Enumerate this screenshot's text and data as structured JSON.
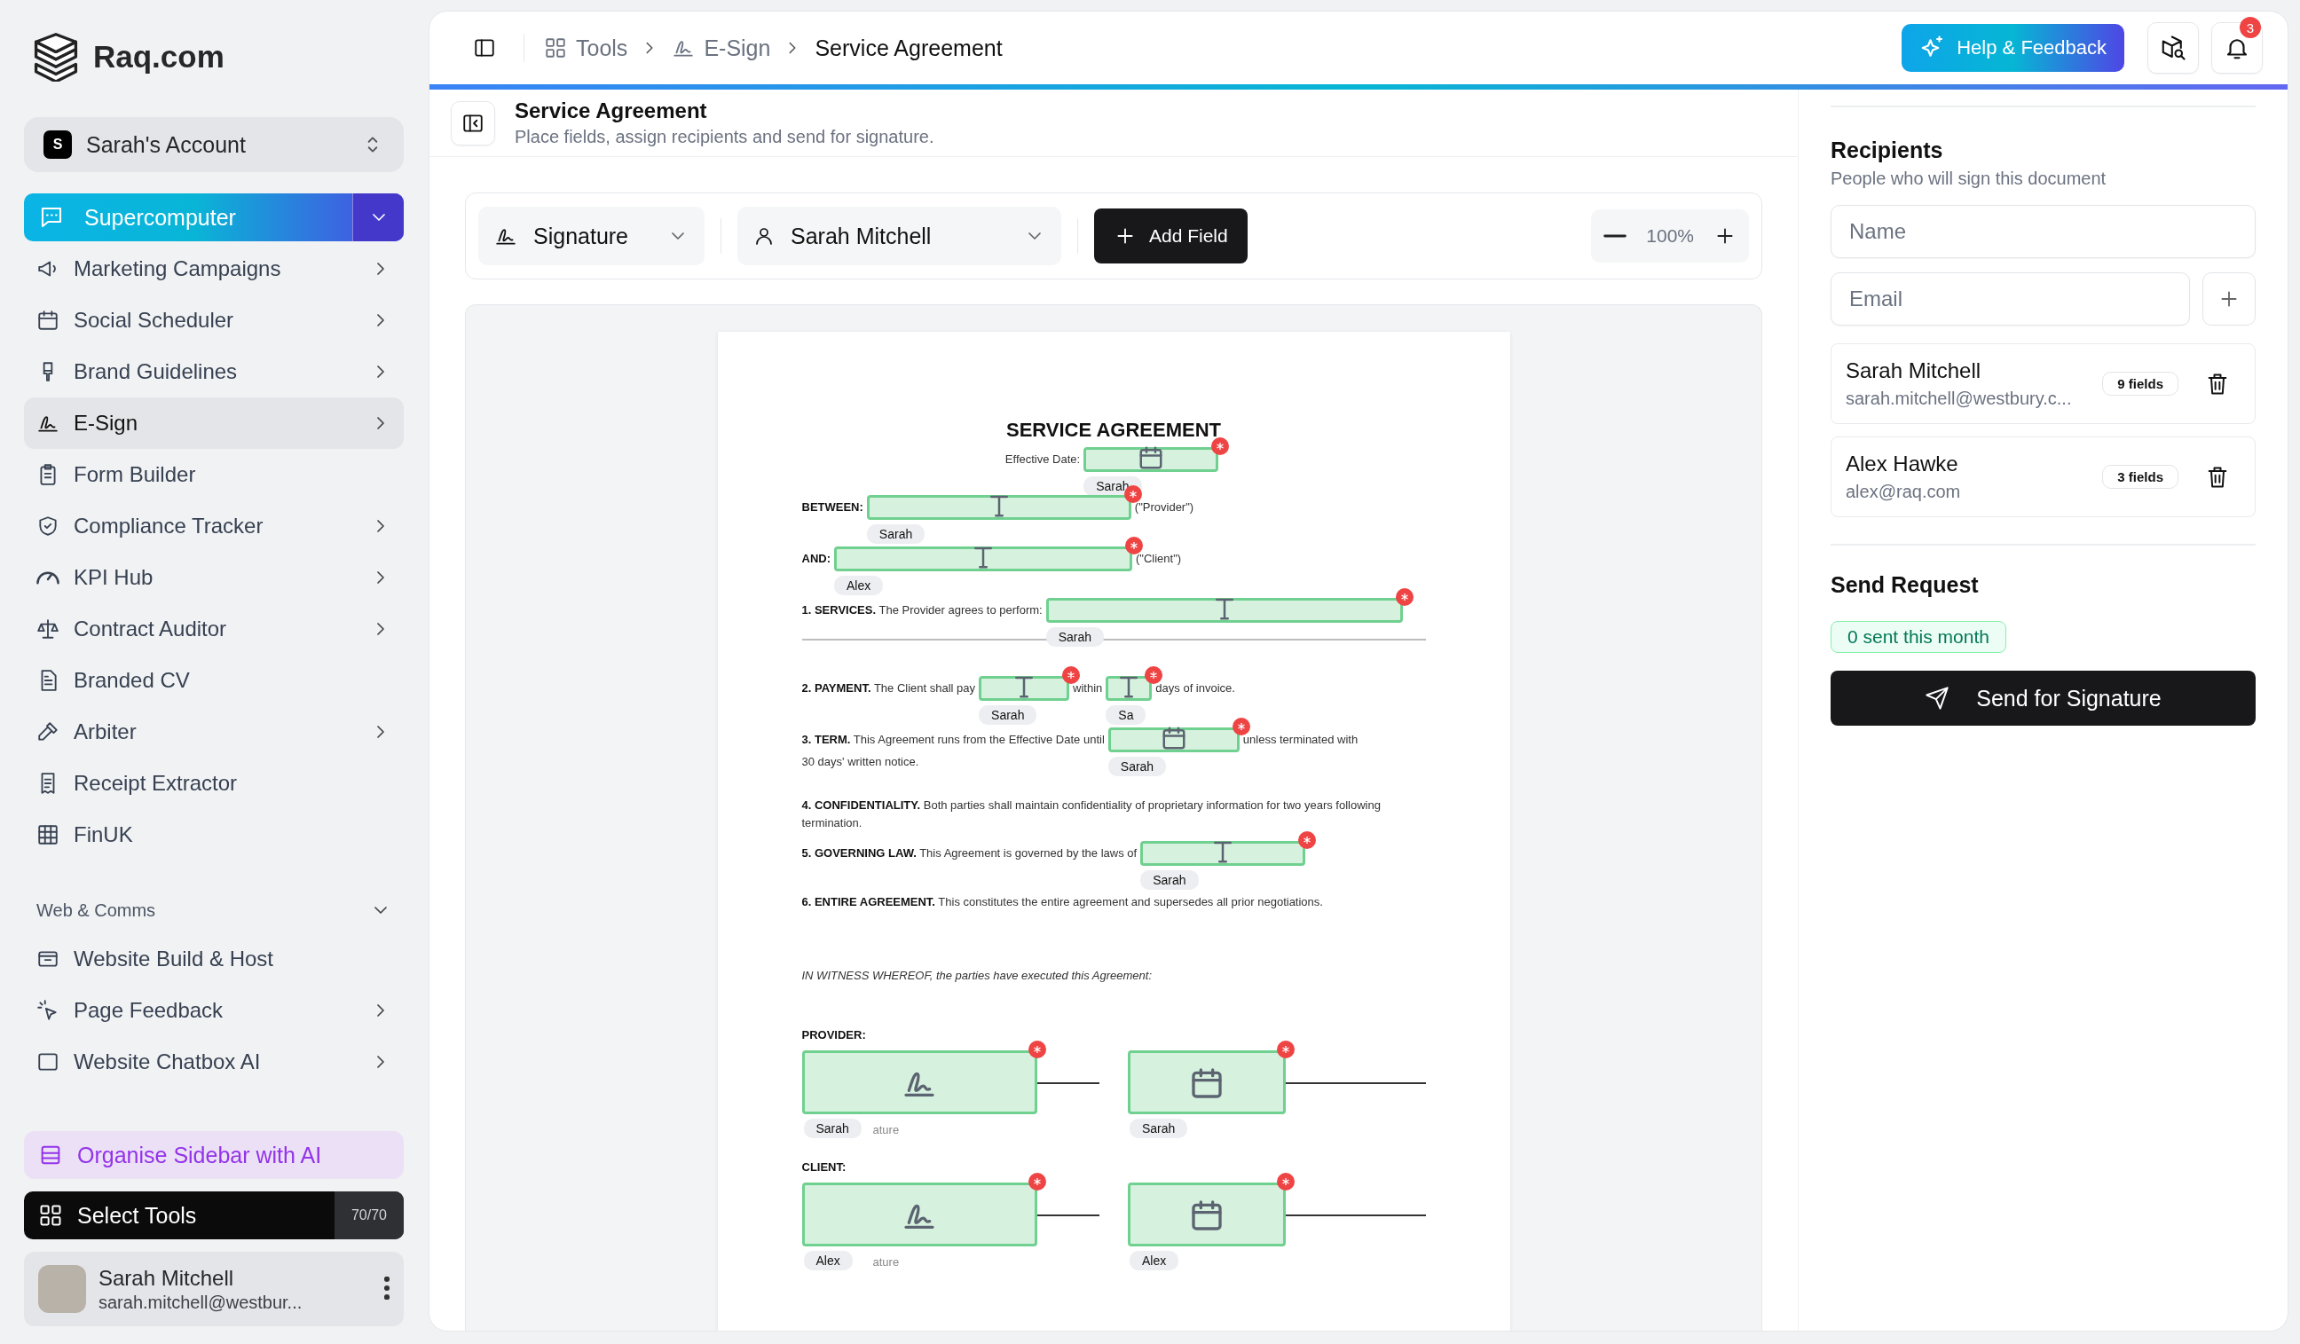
{
  "sidebar": {
    "brand": "Raq.com",
    "account": {
      "initial": "S",
      "name": "Sarah's Account"
    },
    "pinned": {
      "label": "Supercomputer"
    },
    "items": [
      {
        "label": "Marketing Campaigns",
        "submenu": true,
        "selected": false
      },
      {
        "label": "Social Scheduler",
        "submenu": true,
        "selected": false
      },
      {
        "label": "Brand Guidelines",
        "submenu": true,
        "selected": false
      },
      {
        "label": "E-Sign",
        "submenu": true,
        "selected": true
      },
      {
        "label": "Form Builder",
        "submenu": false,
        "selected": false
      },
      {
        "label": "Compliance Tracker",
        "submenu": true,
        "selected": false
      },
      {
        "label": "KPI Hub",
        "submenu": true,
        "selected": false
      },
      {
        "label": "Contract Auditor",
        "submenu": true,
        "selected": false
      },
      {
        "label": "Branded CV",
        "submenu": false,
        "selected": false
      },
      {
        "label": "Arbiter",
        "submenu": true,
        "selected": false
      },
      {
        "label": "Receipt Extractor",
        "submenu": false,
        "selected": false
      },
      {
        "label": "FinUK",
        "submenu": false,
        "selected": false
      }
    ],
    "section": {
      "title": "Web & Comms",
      "expanded": true,
      "items": [
        {
          "label": "Website Build & Host",
          "submenu": false,
          "selected": false
        },
        {
          "label": "Page Feedback",
          "submenu": true,
          "selected": false
        },
        {
          "label": "Website Chatbox AI",
          "submenu": true,
          "selected": false
        }
      ]
    },
    "organise_button": "Organise Sidebar with AI",
    "select_tools": {
      "label": "Select Tools",
      "count": "70/70"
    },
    "user": {
      "name": "Sarah Mitchell",
      "email": "sarah.mitchell@westbur..."
    }
  },
  "topbar": {
    "breadcrumbs": [
      {
        "label": "Tools"
      },
      {
        "label": "E-Sign"
      },
      {
        "label": "Service Agreement"
      }
    ],
    "help_button": "Help & Feedback",
    "notification_count": "3"
  },
  "header": {
    "title": "Service Agreement",
    "subtitle": "Place fields, assign recipients and send for signature."
  },
  "toolbar": {
    "field_type": "Signature",
    "recipient": "Sarah Mitchell",
    "add_button": "Add Field",
    "zoom": "100%"
  },
  "document": {
    "title": "SERVICE AGREEMENT",
    "blocks": [
      {
        "kind": "center_line",
        "parts": [
          {
            "kind": "text",
            "text": "Effective Date:"
          },
          {
            "kind": "date_field",
            "assignee": "Sarah",
            "required": true
          }
        ]
      },
      {
        "kind": "line",
        "parts": [
          {
            "kind": "text",
            "text": "**BETWEEN:**"
          },
          {
            "kind": "text_field",
            "assignee": "Sarah",
            "required": true
          },
          {
            "kind": "text",
            "text": "(\"Provider\")"
          }
        ]
      },
      {
        "kind": "line",
        "parts": [
          {
            "kind": "text",
            "text": "**AND:**"
          },
          {
            "kind": "text_field",
            "assignee": "Alex",
            "required": true
          },
          {
            "kind": "text",
            "text": "(\"Client\")"
          }
        ]
      },
      {
        "kind": "line",
        "parts": [
          {
            "kind": "text",
            "text": "**1. SERVICES.** The Provider agrees to perform:"
          },
          {
            "kind": "text_field",
            "assignee": "Sarah",
            "required": true
          }
        ]
      },
      {
        "kind": "rule"
      },
      {
        "kind": "line",
        "parts": [
          {
            "kind": "text",
            "text": "**2. PAYMENT.** The Client shall pay"
          },
          {
            "kind": "text_field",
            "assignee": "Sarah",
            "required": true
          },
          {
            "kind": "text",
            "text": "within"
          },
          {
            "kind": "text_field",
            "assignee": "Sa",
            "required": true
          },
          {
            "kind": "text",
            "text": "days of invoice."
          }
        ]
      },
      {
        "kind": "line",
        "parts": [
          {
            "kind": "text",
            "text": "**3. TERM.** This Agreement runs from the Effective Date until"
          },
          {
            "kind": "date_field",
            "assignee": "Sarah",
            "required": true
          },
          {
            "kind": "text",
            "text": "unless terminated with"
          }
        ]
      },
      {
        "kind": "continuation",
        "parts": [
          {
            "kind": "text",
            "text": "30 days' written notice."
          }
        ]
      },
      {
        "kind": "line",
        "parts": [
          {
            "kind": "text",
            "text": "**4. CONFIDENTIALITY.** Both parties shall maintain confidentiality of proprietary information for two years following termination."
          }
        ]
      },
      {
        "kind": "line",
        "parts": [
          {
            "kind": "text",
            "text": "**5. GOVERNING LAW.** This Agreement is governed by the laws of"
          },
          {
            "kind": "text_field",
            "assignee": "Sarah",
            "required": true
          }
        ]
      },
      {
        "kind": "line",
        "parts": [
          {
            "kind": "text",
            "text": "**6. ENTIRE AGREEMENT.** This constitutes the entire agreement and supersedes all prior negotiations."
          }
        ]
      },
      {
        "kind": "witness",
        "text": "IN WITNESS WHEREOF, the parties have executed this Agreement:"
      },
      {
        "kind": "signatures",
        "label": "PROVIDER:",
        "slots": [
          {
            "kind": "signature_field",
            "assignee": "Sarah",
            "required": true,
            "caption": "ature"
          },
          {
            "kind": "date_field",
            "assignee": "Sarah",
            "required": true
          }
        ]
      },
      {
        "kind": "signatures",
        "label": "CLIENT:",
        "slots": [
          {
            "kind": "signature_field",
            "assignee": "Alex",
            "required": true,
            "caption": "ature"
          },
          {
            "kind": "date_field",
            "assignee": "Alex",
            "required": true
          }
        ]
      }
    ]
  },
  "recipients": {
    "title": "Recipients",
    "subtitle": "People who will sign this document",
    "name_placeholder": "Name",
    "email_placeholder": "Email",
    "list": [
      {
        "name": "Sarah Mitchell",
        "email": "sarah.mitchell@westbury.c...",
        "fields": "9 fields"
      },
      {
        "name": "Alex Hawke",
        "email": "alex@raq.com",
        "fields": "3 fields"
      }
    ]
  },
  "send": {
    "title": "Send Request",
    "badge": "0 sent this month",
    "button": "Send for Signature"
  }
}
